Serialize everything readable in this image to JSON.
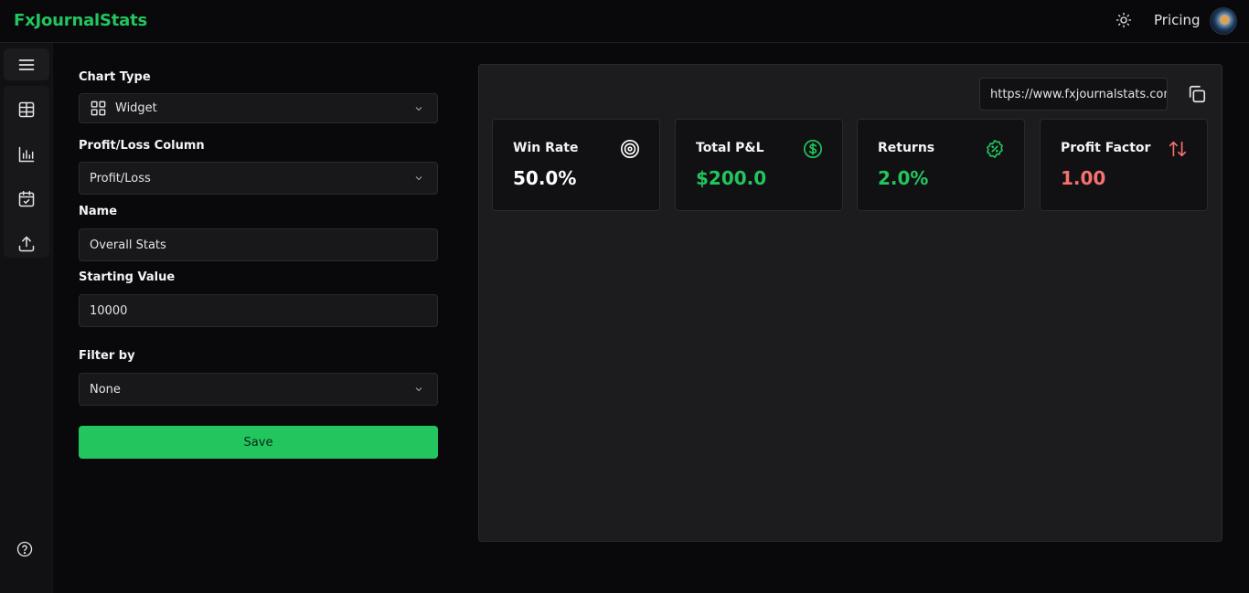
{
  "header": {
    "brand": "FxJournalStats",
    "pricing": "Pricing"
  },
  "form": {
    "chart_type_label": "Chart Type",
    "chart_type_value": "Widget",
    "pl_column_label": "Profit/Loss Column",
    "pl_column_value": "Profit/Loss",
    "name_label": "Name",
    "name_value": "Overall Stats",
    "starting_value_label": "Starting Value",
    "starting_value_value": "10000",
    "filter_label": "Filter by",
    "filter_value": "None",
    "save_label": "Save"
  },
  "preview": {
    "share_url": "https://www.fxjournalstats.com",
    "cards": [
      {
        "title": "Win Rate",
        "value": "50.0%",
        "value_color": "#ffffff",
        "icon": "target-icon"
      },
      {
        "title": "Total P&L",
        "value": "$200.0",
        "value_color": "#22c55e",
        "icon": "dollar-circle-icon"
      },
      {
        "title": "Returns",
        "value": "2.0%",
        "value_color": "#22c55e",
        "icon": "percent-badge-icon"
      },
      {
        "title": "Profit Factor",
        "value": "1.00",
        "value_color": "#f87171",
        "icon": "arrows-up-down-icon"
      }
    ]
  },
  "colors": {
    "accent": "#22c55e",
    "negative": "#f87171",
    "background": "#09090b"
  }
}
